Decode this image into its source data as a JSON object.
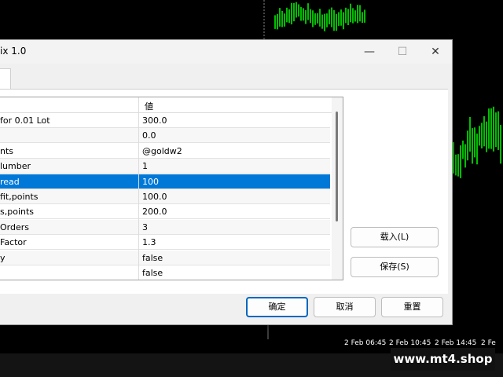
{
  "window": {
    "title": "ix 1.0",
    "minimize_glyph": "—",
    "maximize_glyph": "☐",
    "close_glyph": "✕"
  },
  "grid": {
    "header_value": "値",
    "rows": [
      {
        "name": "for 0.01 Lot",
        "value": "300.0",
        "selected": false
      },
      {
        "name": "",
        "value": "0.0",
        "selected": false
      },
      {
        "name": "nts",
        "value": "@goldw2",
        "selected": false
      },
      {
        "name": "lumber",
        "value": "1",
        "selected": false
      },
      {
        "name": "read",
        "value": "100",
        "selected": true
      },
      {
        "name": "fit,points",
        "value": "100.0",
        "selected": false
      },
      {
        "name": "s,points",
        "value": "200.0",
        "selected": false
      },
      {
        "name": " Orders",
        "value": "3",
        "selected": false
      },
      {
        "name": " Factor",
        "value": "1.3",
        "selected": false
      },
      {
        "name": "y",
        "value": "false",
        "selected": false
      },
      {
        "name": "",
        "value": "false",
        "selected": false
      }
    ]
  },
  "buttons": {
    "load": "载入(L)",
    "save": "保存(S)",
    "ok": "确定",
    "cancel": "取消",
    "reset": "重置"
  },
  "time_axis": [
    "2 Feb 06:45",
    "2 Feb 10:45",
    "2 Feb 14:45",
    "2 Fe"
  ],
  "watermark": "www.mt4.shop",
  "colors": {
    "selection": "#0078d7",
    "candles": "#00ff00",
    "chart_bg": "#000000"
  }
}
